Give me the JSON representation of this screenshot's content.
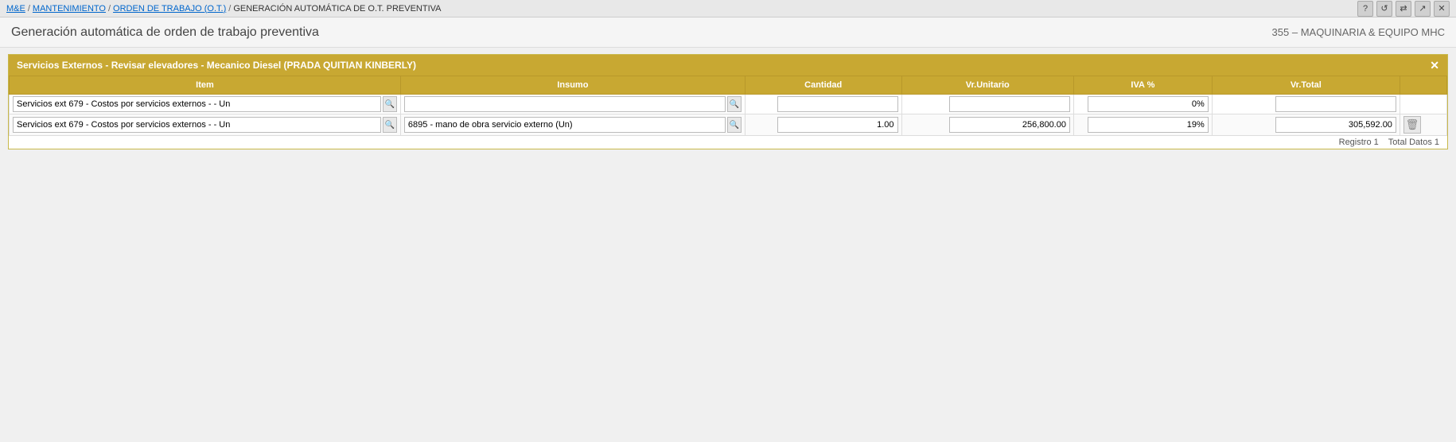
{
  "breadcrumb": {
    "items": [
      {
        "label": "M&E",
        "link": true
      },
      {
        "label": "MANTENIMIENTO",
        "link": true
      },
      {
        "label": "ORDEN DE TRABAJO (O.T.)",
        "link": true
      },
      {
        "label": "GENERACIÓN AUTOMÁTICA DE O.T. PREVENTIVA",
        "link": false
      }
    ],
    "separators": [
      "/",
      "/",
      "/"
    ]
  },
  "topIcons": [
    "?",
    "↺",
    "⇄",
    "↗",
    "✕"
  ],
  "pageHeader": {
    "title": "Generación automática de orden de trabajo preventiva",
    "company": "355 – MAQUINARIA & EQUIPO MHC"
  },
  "sectionPanel": {
    "title": "Servicios Externos - Revisar elevadores - Mecanico Diesel (PRADA QUITIAN KINBERLY)",
    "closeLabel": "✕"
  },
  "table": {
    "columns": [
      {
        "key": "item",
        "label": "Item"
      },
      {
        "key": "insumo",
        "label": "Insumo"
      },
      {
        "key": "cantidad",
        "label": "Cantidad"
      },
      {
        "key": "vrUnitario",
        "label": "Vr.Unitario"
      },
      {
        "key": "iva",
        "label": "IVA %"
      },
      {
        "key": "vrTotal",
        "label": "Vr.Total"
      },
      {
        "key": "actions",
        "label": ""
      }
    ],
    "rows": [
      {
        "item": "Servicios ext 679 - Costos por servicios externos - - Un",
        "insumo": "",
        "cantidad": "",
        "vrUnitario": "",
        "iva": "0%",
        "vrTotal": "",
        "hasDelete": false
      },
      {
        "item": "Servicios ext 679 - Costos por servicios externos - - Un",
        "insumo": "6895 - mano de obra servicio externo (Un)",
        "cantidad": "1.00",
        "vrUnitario": "256,800.00",
        "iva": "19%",
        "vrTotal": "305,592.00",
        "hasDelete": true
      }
    ],
    "footer": {
      "registro": "Registro 1",
      "totalDatos": "Total Datos 1"
    }
  }
}
